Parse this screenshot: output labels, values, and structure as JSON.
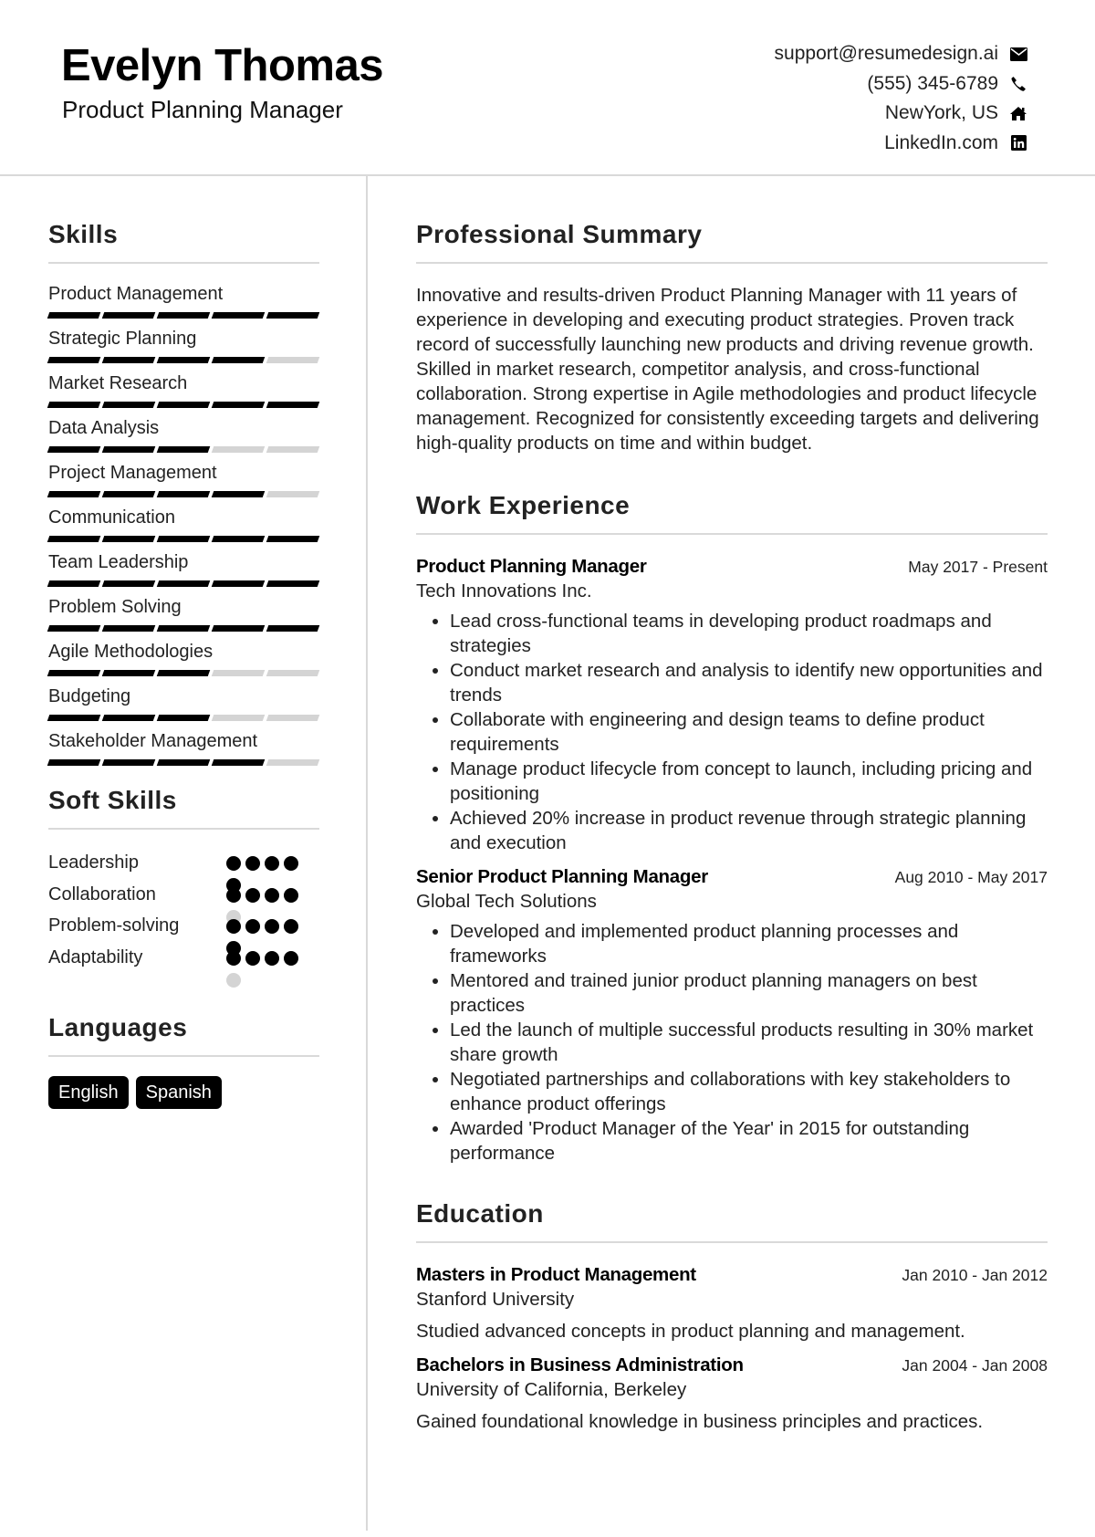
{
  "header": {
    "name": "Evelyn Thomas",
    "title": "Product Planning Manager",
    "contacts": [
      {
        "text": "support@resumedesign.ai",
        "icon": "envelope-icon"
      },
      {
        "text": "(555) 345-6789",
        "icon": "phone-icon"
      },
      {
        "text": "NewYork, US",
        "icon": "home-icon"
      },
      {
        "text": "LinkedIn.com",
        "icon": "linkedin-icon"
      }
    ]
  },
  "skills": {
    "heading": "Skills",
    "max_level": 5,
    "items": [
      {
        "label": "Product Management",
        "level": 5
      },
      {
        "label": "Strategic Planning",
        "level": 4
      },
      {
        "label": "Market Research",
        "level": 5
      },
      {
        "label": "Data Analysis",
        "level": 3
      },
      {
        "label": "Project Management",
        "level": 4
      },
      {
        "label": "Communication",
        "level": 5
      },
      {
        "label": "Team Leadership",
        "level": 5
      },
      {
        "label": "Problem Solving",
        "level": 5
      },
      {
        "label": "Agile Methodologies",
        "level": 3
      },
      {
        "label": "Budgeting",
        "level": 3
      },
      {
        "label": "Stakeholder Management",
        "level": 4
      }
    ]
  },
  "soft_skills": {
    "heading": "Soft Skills",
    "max_level": 5,
    "items": [
      {
        "label": "Leadership",
        "level": 5
      },
      {
        "label": "Collaboration",
        "level": 4
      },
      {
        "label": "Problem-solving",
        "level": 5
      },
      {
        "label": "Adaptability",
        "level": 4
      }
    ]
  },
  "languages": {
    "heading": "Languages",
    "items": [
      "English",
      "Spanish"
    ]
  },
  "summary": {
    "heading": "Professional Summary",
    "text": "Innovative and results-driven Product Planning Manager with 11 years of experience in developing and executing product strategies. Proven track record of successfully launching new products and driving revenue growth. Skilled in market research, competitor analysis, and cross-functional collaboration. Strong expertise in Agile methodologies and product lifecycle management. Recognized for consistently exceeding targets and delivering high-quality products on time and within budget."
  },
  "experience": {
    "heading": "Work Experience",
    "jobs": [
      {
        "title": "Product Planning Manager",
        "company": "Tech Innovations Inc.",
        "dates": "May 2017 - Present",
        "bullets": [
          "Lead cross-functional teams in developing product roadmaps and strategies",
          "Conduct market research and analysis to identify new opportunities and trends",
          "Collaborate with engineering and design teams to define product requirements",
          "Manage product lifecycle from concept to launch, including pricing and positioning",
          "Achieved 20% increase in product revenue through strategic planning and execution"
        ]
      },
      {
        "title": "Senior Product Planning Manager",
        "company": "Global Tech Solutions",
        "dates": "Aug 2010 - May 2017",
        "bullets": [
          "Developed and implemented product planning processes and frameworks",
          "Mentored and trained junior product planning managers on best practices",
          "Led the launch of multiple successful products resulting in 30% market share growth",
          "Negotiated partnerships and collaborations with key stakeholders to enhance product offerings",
          "Awarded 'Product Manager of the Year' in 2015 for outstanding performance"
        ]
      }
    ]
  },
  "education": {
    "heading": "Education",
    "items": [
      {
        "degree": "Masters in Product Management",
        "school": "Stanford University",
        "dates": "Jan 2010 - Jan 2012",
        "description": "Studied advanced concepts in product planning and management."
      },
      {
        "degree": "Bachelors in Business Administration",
        "school": "University of California, Berkeley",
        "dates": "Jan 2004 - Jan 2008",
        "description": "Gained foundational knowledge in business principles and practices."
      }
    ]
  }
}
